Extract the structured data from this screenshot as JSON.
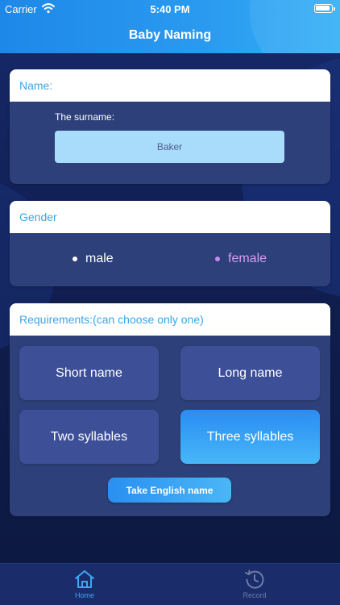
{
  "status_bar": {
    "carrier": "Carrier",
    "time": "5:40 PM",
    "icons": [
      "wifi-icon",
      "battery-icon"
    ]
  },
  "header": {
    "title": "Baby Naming"
  },
  "name_card": {
    "title": "Name:",
    "surname_label": "The surname:",
    "surname_value": "Baker"
  },
  "gender_card": {
    "title": "Gender",
    "options": [
      {
        "label": "male",
        "selected": false
      },
      {
        "label": "female",
        "selected": true
      }
    ]
  },
  "requirements_card": {
    "title": "Requirements:(can choose only one)",
    "options": [
      {
        "label": "Short name",
        "selected": false
      },
      {
        "label": "Long name",
        "selected": false
      },
      {
        "label": "Two syllables",
        "selected": false
      },
      {
        "label": "Three syllables",
        "selected": true
      }
    ],
    "action_label": "Take English name"
  },
  "tabbar": {
    "tabs": [
      {
        "label": "Home",
        "icon": "home-icon",
        "active": true
      },
      {
        "label": "Record",
        "icon": "record-icon",
        "active": false
      }
    ]
  },
  "colors": {
    "header": "#2a9af0",
    "card": "#2e4079",
    "accent": "#3aa6e6",
    "female": "#d59bf3",
    "tab_active": "#3fa6f2"
  }
}
